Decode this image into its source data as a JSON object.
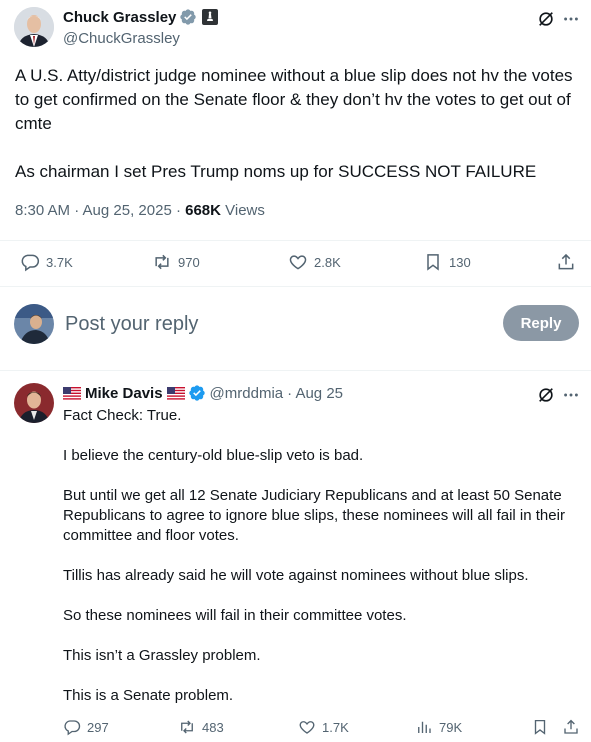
{
  "main_post": {
    "author_name": "Chuck Grassley",
    "author_handle": "@ChuckGrassley",
    "paragraphs": [
      "A U.S. Atty/district judge nominee without a blue slip does not hv the votes to get confirmed on the Senate floor & they don’t hv the votes to get out of cmte",
      "As chairman I set Pres Trump noms up for SUCCESS NOT FAILURE"
    ],
    "timestamp": "8:30 AM · Aug 25, 2025 · ",
    "views_count": "668K",
    "views_label": " Views",
    "stats": {
      "replies": "3.7K",
      "reposts": "970",
      "likes": "2.8K",
      "bookmarks": "130"
    }
  },
  "composer": {
    "placeholder": "Post your reply",
    "reply_button": "Reply"
  },
  "reply_post": {
    "author_name": "Mike Davis",
    "author_handle": "@mrddmia",
    "date": "· Aug 25",
    "paragraphs": [
      "Fact Check: True.",
      "I believe the century-old blue-slip veto is bad.",
      "But until we get all 12 Senate Judiciary Republicans and at least 50 Senate Republicans to agree to ignore blue slips, these nominees will all fail in their committee and floor votes.",
      "Tillis has already said he will vote against nominees without blue slips.",
      "So these nominees will fail in their committee votes.",
      "This isn’t a Grassley problem.",
      "This is a Senate problem."
    ],
    "stats": {
      "replies": "297",
      "reposts": "483",
      "likes": "1.7K",
      "views": "79K"
    }
  },
  "colors": {
    "verified": "#1d9bf0",
    "text": "#0f1419",
    "muted": "#536471",
    "reply_button_bg": "#8b98a5"
  },
  "icons": [
    "verified-badge-icon",
    "gov-badge-icon",
    "grok-icon",
    "more-icon",
    "reply-icon",
    "repost-icon",
    "like-icon",
    "bookmark-icon",
    "share-icon",
    "views-icon",
    "us-flag-icon"
  ]
}
